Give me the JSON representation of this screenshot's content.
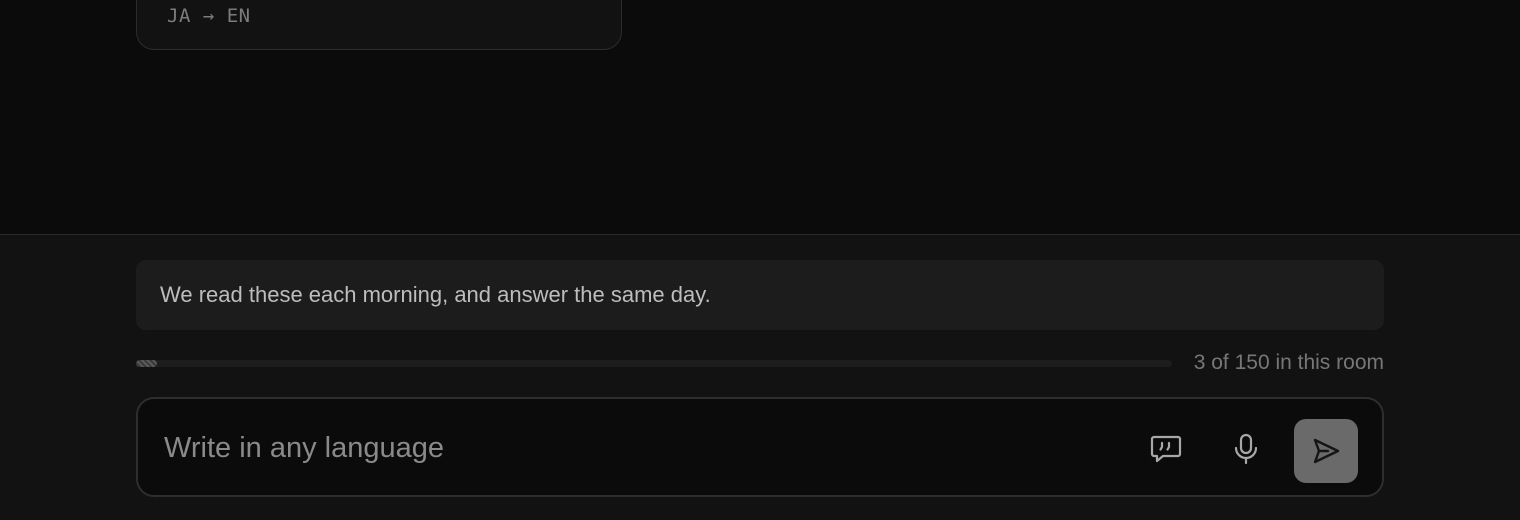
{
  "message": {
    "lang_pair": "JA → EN"
  },
  "composer": {
    "notice": "We read these each morning, and answer the same day.",
    "quota": {
      "used": 3,
      "total": 150,
      "label": "3 of 150 in this room"
    },
    "input": {
      "placeholder": "Write in any language",
      "value": ""
    },
    "buttons": {
      "quote_icon": "quote-bubble-icon",
      "mic_icon": "microphone-icon",
      "send_icon": "send-icon"
    }
  },
  "colors": {
    "background_top": "#0b0b0b",
    "background_composer": "#121212",
    "notice_bg": "#1c1c1c",
    "send_bg": "#6a6a6a"
  }
}
